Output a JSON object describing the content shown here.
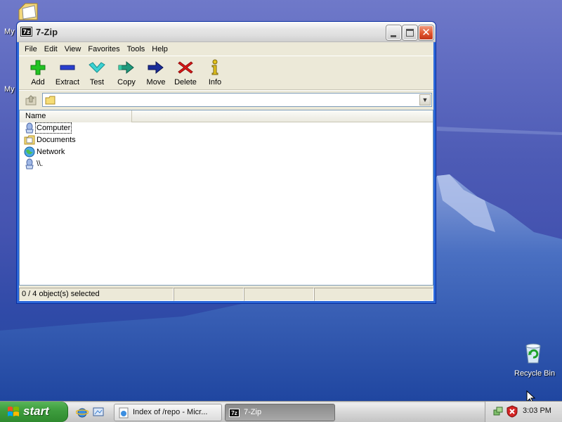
{
  "desktop": {
    "icons": [
      {
        "label": "My"
      },
      {
        "label": "My"
      },
      {
        "label": "Recycle Bin"
      }
    ]
  },
  "window": {
    "title": "7-Zip",
    "app_icon_text": "7z",
    "menu": [
      "File",
      "Edit",
      "View",
      "Favorites",
      "Tools",
      "Help"
    ],
    "toolbar": [
      {
        "label": "Add",
        "icon": "add-icon"
      },
      {
        "label": "Extract",
        "icon": "extract-icon"
      },
      {
        "label": "Test",
        "icon": "test-icon"
      },
      {
        "label": "Copy",
        "icon": "copy-icon"
      },
      {
        "label": "Move",
        "icon": "move-icon"
      },
      {
        "label": "Delete",
        "icon": "delete-icon"
      },
      {
        "label": "Info",
        "icon": "info-icon"
      }
    ],
    "address": {
      "value": ""
    },
    "list": {
      "columns": [
        "Name"
      ],
      "rows": [
        {
          "name": "Computer",
          "icon": "computer-icon"
        },
        {
          "name": "Documents",
          "icon": "documents-folder-icon"
        },
        {
          "name": "Network",
          "icon": "network-icon"
        },
        {
          "name": "\\\\.",
          "icon": "computer-icon"
        }
      ]
    },
    "status": {
      "text": "0 / 4 object(s) selected"
    }
  },
  "taskbar": {
    "start_label": "start",
    "tasks": [
      {
        "label": "Index of /repo - Micr..."
      },
      {
        "label": "7-Zip"
      }
    ],
    "clock": "3:03 PM"
  },
  "colors": {
    "window_frame": "#2b67d8",
    "client_bg": "#ece9d8",
    "start_green": "#3d9c3d"
  }
}
